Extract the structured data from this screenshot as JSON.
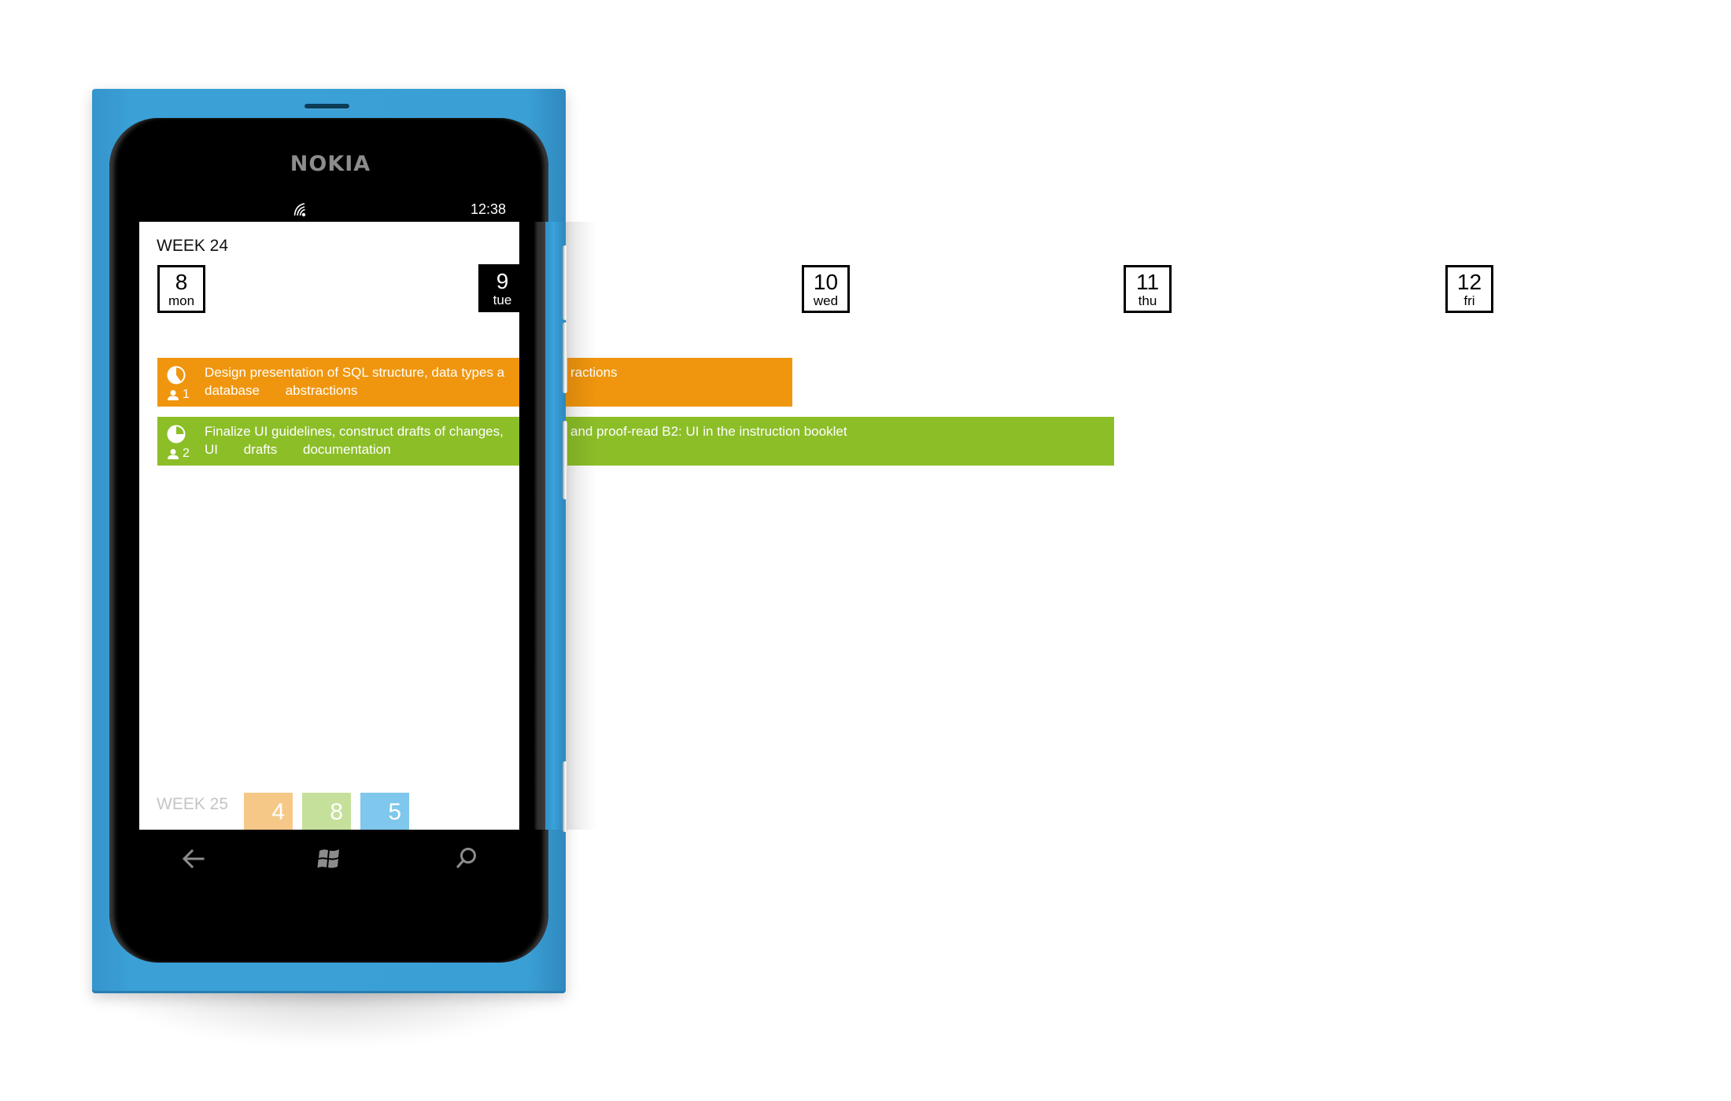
{
  "device": {
    "brand": "NOKIA",
    "body_color": "#3a9fd5"
  },
  "status_bar": {
    "signal_icon": "wifi-signal-icon",
    "time": "12:38"
  },
  "calendar": {
    "week_title": "WEEK 24",
    "days": [
      {
        "num": "8",
        "weekday": "mon",
        "active": false
      },
      {
        "num": "9",
        "weekday": "tue",
        "active": true
      },
      {
        "num": "10",
        "weekday": "wed",
        "active": false
      },
      {
        "num": "11",
        "weekday": "thu",
        "active": false
      },
      {
        "num": "12",
        "weekday": "fri",
        "active": false
      }
    ],
    "tasks": [
      {
        "title": "Design presentation of SQL structure, data types and abstractions",
        "title_visible_left": "Design presentation of SQL structure, data types a",
        "title_visible_right": "ractions",
        "tags": [
          "database",
          "abstractions"
        ],
        "people": "1",
        "progress": 0.6,
        "color": "#f0960e",
        "span_days": "mon–tue"
      },
      {
        "title": "Finalize UI guidelines, construct drafts of changes, and proof-read B2: UI in the instruction booklet",
        "title_visible_left": "Finalize UI guidelines, construct drafts of changes,",
        "title_visible_right": "and proof-read B2: UI in the instruction booklet",
        "tags": [
          "UI",
          "drafts",
          "documentation"
        ],
        "people": "2",
        "progress": 0.75,
        "color": "#8cbe28",
        "span_days": "mon–wed"
      }
    ],
    "next_week": {
      "title": "WEEK 25",
      "counts": [
        {
          "value": "4",
          "color": "#f6c887"
        },
        {
          "value": "8",
          "color": "#c5e09a"
        },
        {
          "value": "5",
          "color": "#7fc7ec"
        }
      ]
    }
  },
  "nav_bar": {
    "back": "back-arrow-icon",
    "home": "windows-logo-icon",
    "search": "search-icon"
  }
}
